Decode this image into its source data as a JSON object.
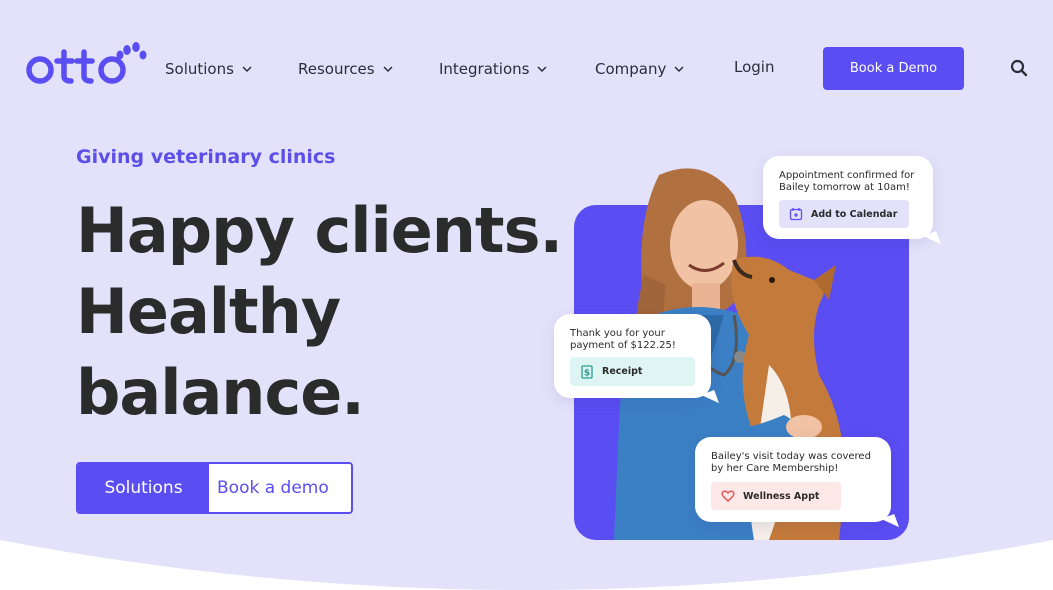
{
  "brand": {
    "name": "otto",
    "accent": "#5a4df2",
    "background": "#e4e2fa"
  },
  "nav": {
    "items": [
      {
        "label": "Solutions",
        "icon": "chevron-down-icon"
      },
      {
        "label": "Resources",
        "icon": "chevron-down-icon"
      },
      {
        "label": "Integrations",
        "icon": "chevron-down-icon"
      },
      {
        "label": "Company",
        "icon": "chevron-down-icon"
      }
    ],
    "login": "Login",
    "cta": "Book a Demo",
    "search_icon": "search-icon"
  },
  "hero": {
    "eyebrow": "Giving veterinary clinics",
    "headline": [
      "Happy clients.",
      "Healthy",
      "balance."
    ],
    "primary_button": "Solutions",
    "secondary_button": "Book a demo"
  },
  "bubbles": {
    "appointment": {
      "message": "Appointment confirmed for Bailey tomorrow at 10am!",
      "chip": "Add to Calendar",
      "icon": "calendar-plus-icon",
      "chip_color": "#e4e2fa"
    },
    "payment": {
      "message": "Thank you for your payment of $122.25!",
      "chip": "Receipt",
      "icon": "receipt-icon",
      "chip_color": "#def5f3"
    },
    "membership": {
      "message": "Bailey's visit today was covered by her Care Membership!",
      "chip": "Wellness Appt",
      "icon": "heart-icon",
      "chip_color": "#fde8e8"
    }
  }
}
